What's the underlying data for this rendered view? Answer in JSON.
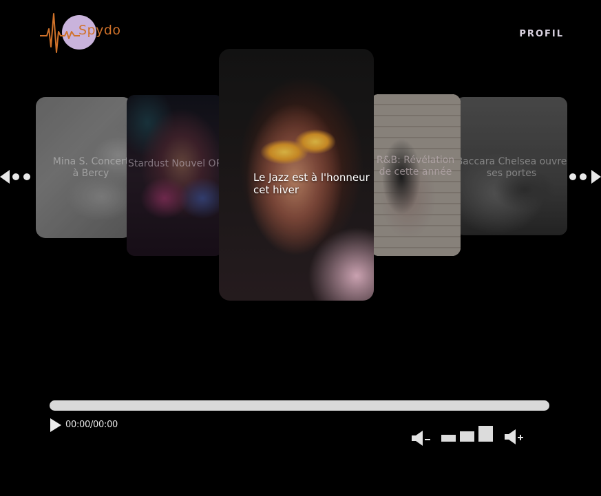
{
  "brand": {
    "name": "Spydo",
    "colors": {
      "logo_text": "#d0722a",
      "logo_circle": "#c9b3dc"
    }
  },
  "nav": {
    "profil_label": "PROFIL"
  },
  "carousel": {
    "arrows": {
      "left_icon": "arrow-left-dots-icon",
      "right_icon": "arrow-right-dots-icon"
    },
    "cards": [
      {
        "title": "Mina S. Concert à Bercy"
      },
      {
        "title": "Stardust Nouvel OP"
      },
      {
        "title": "Le Jazz est à l'honneur cet hiver"
      },
      {
        "title": "R&B: Révélation de cette année"
      },
      {
        "title": "Baccara Chelsea ouvre ses portes"
      }
    ]
  },
  "player": {
    "progress_fraction": 0,
    "time": "00:00/00:00",
    "volume_level": 3,
    "volume_max": 3,
    "icons": {
      "play": "play-icon",
      "volume_down": "volume-down-icon",
      "volume_up": "volume-up-icon"
    }
  }
}
